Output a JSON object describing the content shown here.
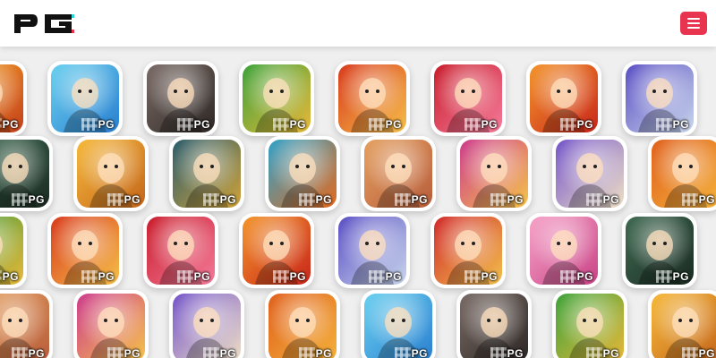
{
  "header": {
    "logo_text": "PG",
    "menu_icon": "hamburger-menu-icon",
    "menu_color": "#e8344e"
  },
  "tile_badge": "PG",
  "rows": [
    {
      "tiles": [
        {
          "theme": "partial-orange",
          "colors": [
            "#f7a628",
            "#c4401b"
          ]
        },
        {
          "theme": "adventure-boy",
          "colors": [
            "#6ad0ef",
            "#2a7fd0"
          ]
        },
        {
          "theme": "dark-hair-woman",
          "colors": [
            "#7a6b66",
            "#2d2724"
          ]
        },
        {
          "theme": "money-tree",
          "colors": [
            "#3da33a",
            "#e9b83a"
          ]
        },
        {
          "theme": "fortune-god",
          "colors": [
            "#d83a1c",
            "#f6c04a"
          ]
        },
        {
          "theme": "lucky-piggy",
          "colors": [
            "#c91d2c",
            "#f47b9a"
          ]
        },
        {
          "theme": "golden-dragon",
          "colors": [
            "#f3942a",
            "#c9261b"
          ]
        },
        {
          "theme": "panda-chef",
          "colors": [
            "#5a4fc4",
            "#c9d7ec"
          ]
        },
        {
          "theme": "partial-gold",
          "colors": [
            "#f7c334",
            "#d2691e"
          ]
        }
      ]
    },
    {
      "tiles": [
        {
          "theme": "medusa",
          "colors": [
            "#3f6a51",
            "#1a2a22"
          ]
        },
        {
          "theme": "archer-monkey",
          "colors": [
            "#f6b93b",
            "#c4651a"
          ]
        },
        {
          "theme": "scarab",
          "colors": [
            "#2a5c6c",
            "#d0a33a"
          ]
        },
        {
          "theme": "pumpkin",
          "colors": [
            "#2fa2c9",
            "#e66a1d"
          ]
        },
        {
          "theme": "ganesha",
          "colors": [
            "#e4a060",
            "#b85d3b"
          ]
        },
        {
          "theme": "golden-sword",
          "colors": [
            "#cd3b8d",
            "#f6c54a"
          ]
        },
        {
          "theme": "zeus-king",
          "colors": [
            "#7454c9",
            "#efe1c6"
          ]
        },
        {
          "theme": "hot-pot",
          "colors": [
            "#e0601d",
            "#f4b23b"
          ]
        }
      ]
    },
    {
      "tiles": [
        {
          "theme": "partial-tree",
          "colors": [
            "#3a9a37",
            "#e9b83a"
          ]
        },
        {
          "theme": "fortune-god",
          "colors": [
            "#d83a1c",
            "#f6c04a"
          ]
        },
        {
          "theme": "lucky-piggy",
          "colors": [
            "#c91d2c",
            "#f47b9a"
          ]
        },
        {
          "theme": "golden-dragon",
          "colors": [
            "#f3942a",
            "#c9261b"
          ]
        },
        {
          "theme": "panda-chef",
          "colors": [
            "#5a4fc4",
            "#c9d7ec"
          ]
        },
        {
          "theme": "lion-dance",
          "colors": [
            "#d12a2a",
            "#f2c14e"
          ]
        },
        {
          "theme": "pink-princess",
          "colors": [
            "#f6a3c8",
            "#c94386"
          ]
        },
        {
          "theme": "medusa",
          "colors": [
            "#3f6a51",
            "#1a2a22"
          ]
        }
      ]
    },
    {
      "tiles": [
        {
          "theme": "partial-ganesha",
          "colors": [
            "#e4a060",
            "#b85d3b"
          ]
        },
        {
          "theme": "golden-sword",
          "colors": [
            "#cd3b8d",
            "#f6c54a"
          ]
        },
        {
          "theme": "zeus-king",
          "colors": [
            "#7454c9",
            "#efe1c6"
          ]
        },
        {
          "theme": "hot-pot",
          "colors": [
            "#e0601d",
            "#f4b23b"
          ]
        },
        {
          "theme": "adventure-boy",
          "colors": [
            "#6ad0ef",
            "#2a7fd0"
          ]
        },
        {
          "theme": "dark-hair-woman",
          "colors": [
            "#7a6b66",
            "#2d2724"
          ]
        },
        {
          "theme": "money-tree",
          "colors": [
            "#3da33a",
            "#e9b83a"
          ]
        },
        {
          "theme": "archer-monkey",
          "colors": [
            "#f6b93b",
            "#c4651a"
          ]
        }
      ]
    }
  ]
}
